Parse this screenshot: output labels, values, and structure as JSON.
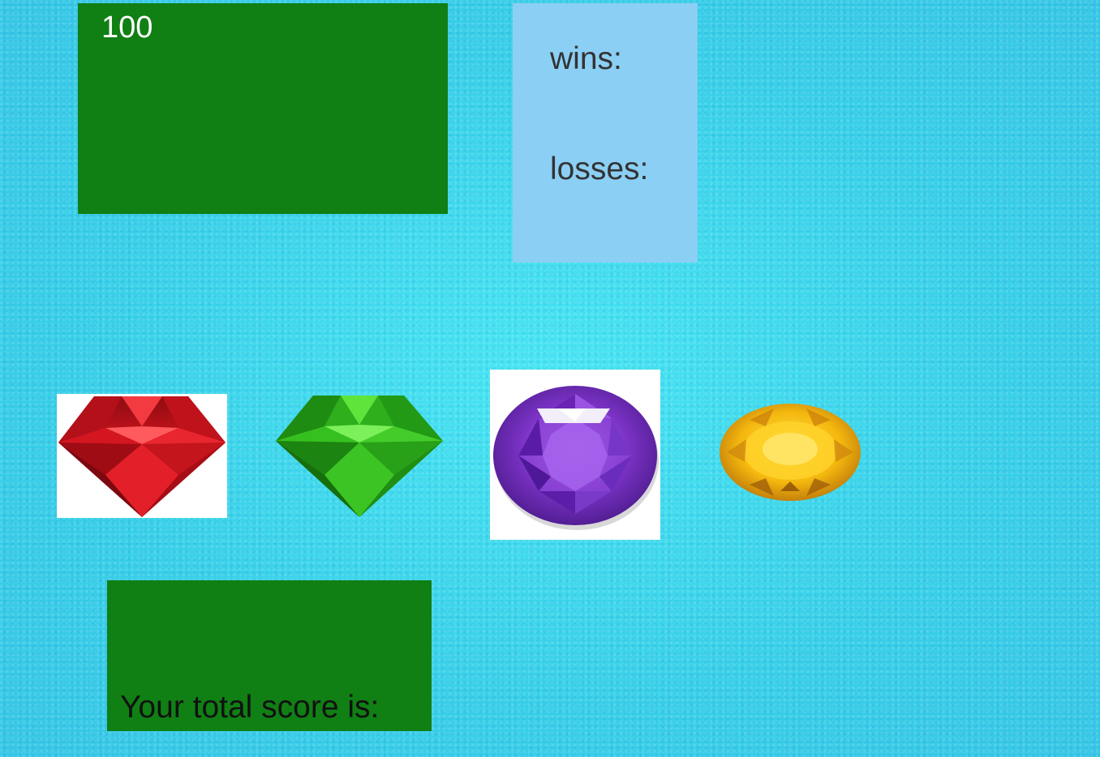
{
  "game": {
    "target_number": "100",
    "wins_label": "wins:",
    "wins_value": "",
    "losses_label": "losses:",
    "losses_value": "",
    "score_label": "Your total score is:",
    "score_value": ""
  },
  "gems": [
    {
      "name": "ruby",
      "icon": "red-diamond-gem-icon",
      "color": "#d4121c"
    },
    {
      "name": "emerald",
      "icon": "green-diamond-gem-icon",
      "color": "#2fc41c"
    },
    {
      "name": "amethyst",
      "icon": "purple-round-gem-icon",
      "color": "#7a32c4"
    },
    {
      "name": "citrine",
      "icon": "yellow-oval-gem-icon",
      "color": "#f2b40c"
    }
  ],
  "colors": {
    "background": "#3fd9ea",
    "target_box": "#107f14",
    "stats_box": "#8bcff5",
    "score_box": "#107f14"
  }
}
